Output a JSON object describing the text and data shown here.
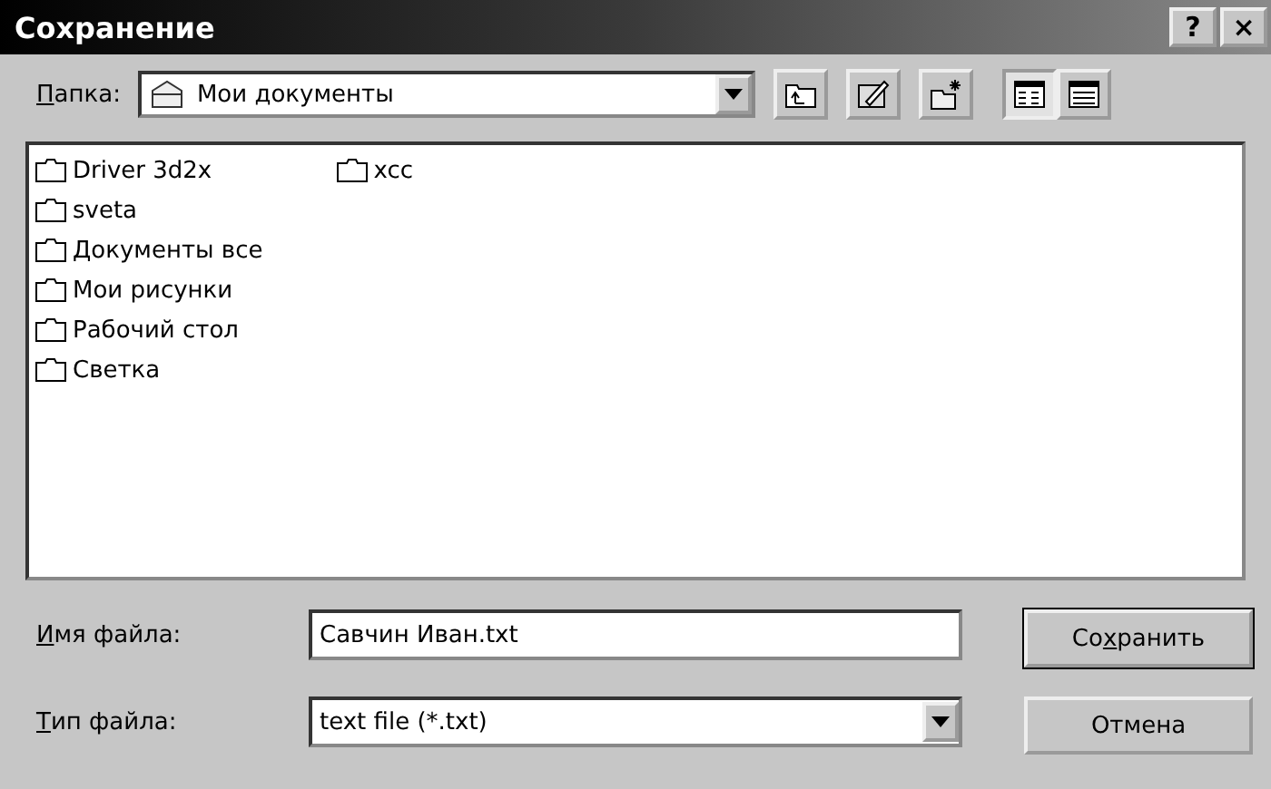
{
  "window": {
    "title": "Сохранение",
    "title_buttons": [
      "?",
      "×"
    ]
  },
  "folder_bar": {
    "label": {
      "key": "П",
      "after": "апка:"
    },
    "value": "Мои документы"
  },
  "view_buttons": [
    {
      "kind": "list",
      "selected": true
    },
    {
      "kind": "details",
      "selected": false
    }
  ],
  "files": [
    {
      "name": "Driver 3d2x"
    },
    {
      "name": "sveta"
    },
    {
      "name": "Документы все"
    },
    {
      "name": "Мои рисунки"
    },
    {
      "name": "Рабочий стол"
    },
    {
      "name": "Светка"
    },
    {
      "name": "xcc"
    }
  ],
  "file_name": {
    "label": {
      "key": "И",
      "after": "мя файла:"
    },
    "value": "Савчин Иван.txt"
  },
  "file_type": {
    "label": {
      "key": "Т",
      "after": "ип файла:"
    },
    "value": "text file (*.txt)"
  },
  "buttons": [
    {
      "label": {
        "before": "Со",
        "key": "х",
        "after": "ранить"
      },
      "default": true
    },
    {
      "label": {
        "after": "Отмена"
      },
      "default": false
    }
  ]
}
